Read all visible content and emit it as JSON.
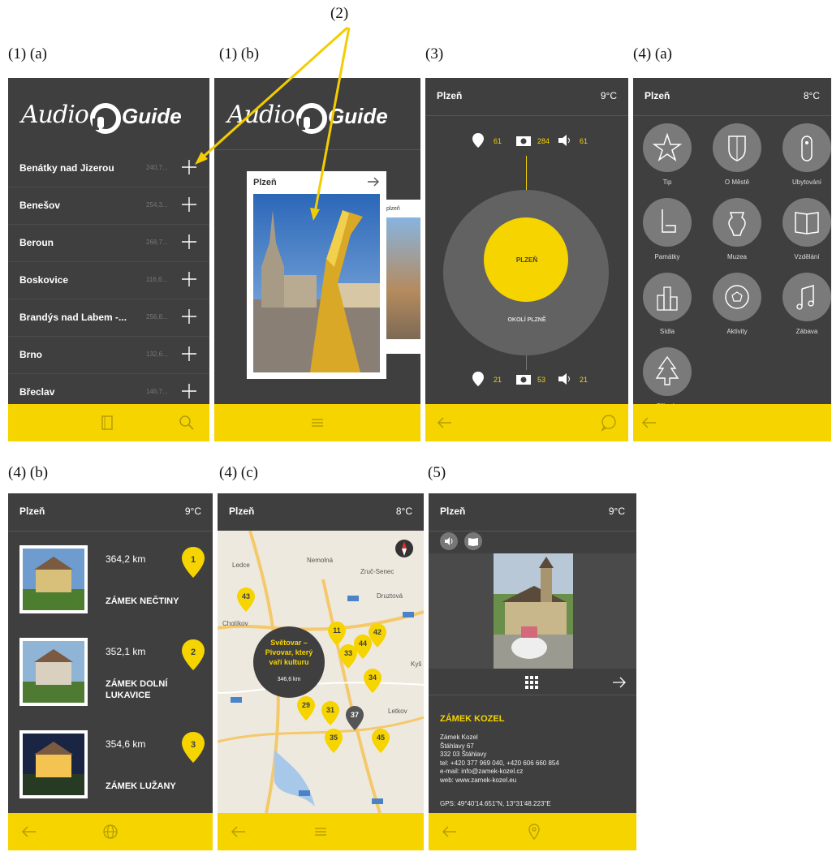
{
  "captions": {
    "c1a": "(1) (a)",
    "c1b": "(1) (b)",
    "c2": "(2)",
    "c3": "(3)",
    "c4a": "(4) (a)",
    "c4b": "(4) (b)",
    "c4c": "(4) (c)",
    "c5": "(5)"
  },
  "logo": {
    "audio": "Audio",
    "guide": "Guide"
  },
  "s1a": {
    "cities": [
      {
        "name": "Benátky nad Jizerou",
        "dist": "240,7..."
      },
      {
        "name": "Benešov",
        "dist": "254,3..."
      },
      {
        "name": "Beroun",
        "dist": "268,7..."
      },
      {
        "name": "Boskovice",
        "dist": "116,6..."
      },
      {
        "name": "Brandýs nad Labem -...",
        "dist": "256,8..."
      },
      {
        "name": "Brno",
        "dist": "132,6..."
      },
      {
        "name": "Břeclav",
        "dist": "146,7..."
      }
    ]
  },
  "s1b": {
    "card_title": "Plzeň",
    "card2_title": "plzeň"
  },
  "s3": {
    "city": "Plzeň",
    "temp": "9°C",
    "top_stats": {
      "places": "61",
      "photos": "284",
      "audio": "61"
    },
    "bottom_stats": {
      "places": "21",
      "photos": "53",
      "audio": "21"
    },
    "inner_label": "PLZEŇ",
    "outer_label": "OKOLÍ PLZNĚ"
  },
  "s4a": {
    "city": "Plzeň",
    "temp": "8°C",
    "categories": [
      "Tip",
      "O Městě",
      "Ubytování",
      "Památky",
      "Muzea",
      "Vzdělání",
      "Sídla",
      "Aktivity",
      "Zábava",
      "Příroda"
    ]
  },
  "s4b": {
    "city": "Plzeň",
    "temp": "9°C",
    "items": [
      {
        "dist": "364,2 km",
        "title": "ZÁMEK NEČTINY",
        "num": "1"
      },
      {
        "dist": "352,1 km",
        "title": "ZÁMEK DOLNÍ LUKAVICE",
        "num": "2"
      },
      {
        "dist": "354,6 km",
        "title": "ZÁMEK LUŽANY",
        "num": "3"
      }
    ]
  },
  "s4c": {
    "city": "Plzeň",
    "temp": "8°C",
    "popup_title": "Světovar – Pivovar, který vaří kulturu",
    "popup_dist": "346,6 km",
    "places": [
      "Ledce",
      "Nemolná",
      "Zruč-Senec",
      "Chotíkov",
      "Druztová",
      "Letkov",
      "Kyš"
    ],
    "markers": [
      "43",
      "11",
      "42",
      "44",
      "33",
      "34",
      "29",
      "31",
      "35",
      "37",
      "45"
    ]
  },
  "s5": {
    "city": "Plzeň",
    "temp": "9°C",
    "title": "ZÁMEK KOZEL",
    "address": [
      "Zámek Kozel",
      "Štáhlavy 67",
      "332 03 Štáhlavy",
      "tel: +420 377 969 040, +420 606 660 854",
      "e-mail: info@zamek-kozel.cz",
      "web: www.zamek-kozel.eu"
    ],
    "gps": "GPS: 49°40'14.651\"N, 13°31'48.223\"E"
  },
  "colors": {
    "accent": "#f6d400",
    "screen": "#3f3f3f",
    "dark": "#2e2e2e"
  }
}
